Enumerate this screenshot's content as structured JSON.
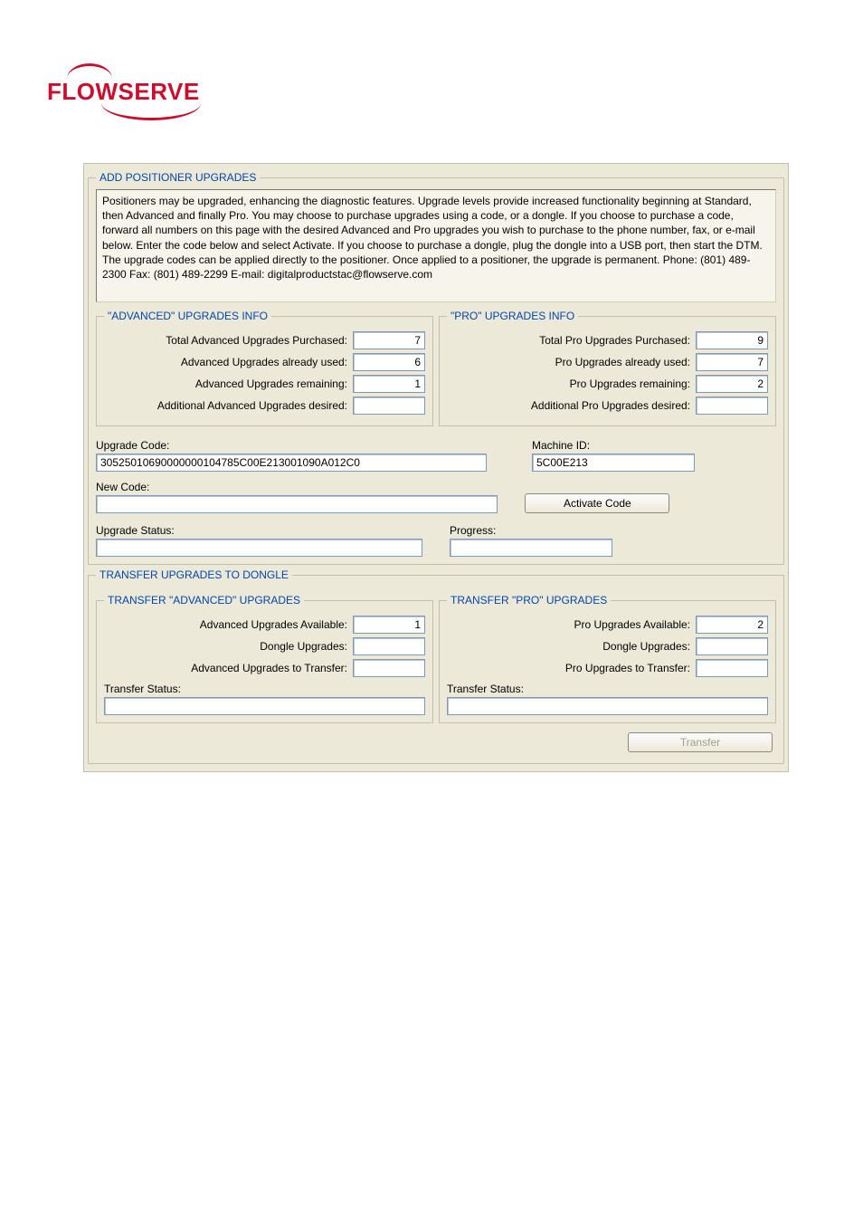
{
  "logo_text": "FLOWSERVE",
  "panel": {
    "title": "ADD POSITIONER UPGRADES",
    "description": "Positioners may be upgraded, enhancing the diagnostic features.  Upgrade levels provide increased functionality beginning at Standard, then Advanced and finally Pro.  You may choose to purchase upgrades  using a code, or a dongle.  If you choose to purchase a code, forward all numbers on this page with the desired Advanced and Pro upgrades you wish to purchase to the phone number, fax, or e-mail below.  Enter the code below and select Activate.  If you choose to purchase a dongle, plug the dongle into a USB port, then start the DTM.  The upgrade codes can be applied directly to the positioner.  Once applied to a positioner, the upgrade is permanent.  Phone: (801) 489-2300 Fax: (801) 489-2299  E-mail: digitalproductstac@flowserve.com",
    "advanced": {
      "title": "\"ADVANCED\" UPGRADES INFO",
      "labels": {
        "purchased": "Total Advanced Upgrades Purchased:",
        "used": "Advanced Upgrades already used:",
        "remaining": "Advanced Upgrades remaining:",
        "desired": "Additional Advanced Upgrades desired:"
      },
      "values": {
        "purchased": "7",
        "used": "6",
        "remaining": "1",
        "desired": ""
      }
    },
    "pro": {
      "title": "\"PRO\" UPGRADES INFO",
      "labels": {
        "purchased": "Total Pro Upgrades Purchased:",
        "used": "Pro Upgrades already used:",
        "remaining": "Pro Upgrades remaining:",
        "desired": "Additional Pro Upgrades desired:"
      },
      "values": {
        "purchased": "9",
        "used": "7",
        "remaining": "2",
        "desired": ""
      }
    },
    "upgrade_code": {
      "label": "Upgrade Code:",
      "value": "30525010690000000104785C00E213001090A012C0"
    },
    "machine_id": {
      "label": "Machine ID:",
      "value": "5C00E213"
    },
    "new_code_label": "New Code:",
    "new_code_value": "",
    "activate_btn": "Activate Code",
    "upgrade_status_label": "Upgrade Status:",
    "upgrade_status_value": "",
    "progress_label": "Progress:",
    "progress_value": ""
  },
  "transfer": {
    "title": "TRANSFER UPGRADES TO DONGLE",
    "adv": {
      "title": "TRANSFER \"ADVANCED\" UPGRADES",
      "labels": {
        "available": "Advanced Upgrades Available:",
        "dongle": "Dongle Upgrades:",
        "to_transfer": "Advanced Upgrades to Transfer:"
      },
      "values": {
        "available": "1",
        "dongle": "",
        "to_transfer": ""
      },
      "status_label": "Transfer Status:",
      "status_value": ""
    },
    "pro": {
      "title": "TRANSFER \"PRO\" UPGRADES",
      "labels": {
        "available": "Pro Upgrades Available:",
        "dongle": "Dongle Upgrades:",
        "to_transfer": "Pro Upgrades to Transfer:"
      },
      "values": {
        "available": "2",
        "dongle": "",
        "to_transfer": ""
      },
      "status_label": "Transfer Status:",
      "status_value": ""
    },
    "transfer_btn": "Transfer"
  }
}
